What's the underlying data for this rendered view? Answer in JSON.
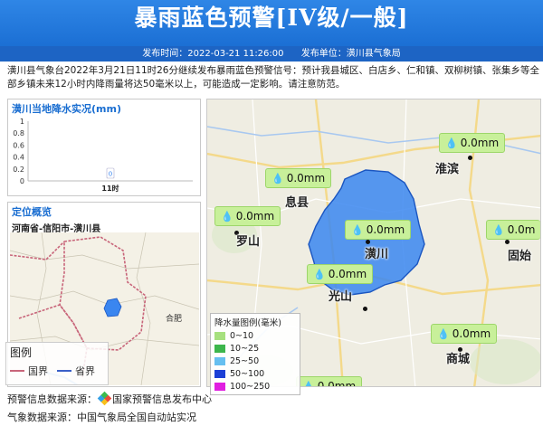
{
  "banner": {
    "title": "暴雨蓝色预警[IV级/一般]"
  },
  "meta": {
    "publish_time": "发布时间：2022-03-21 11:26:00",
    "publisher": "发布单位：潢川县气象局"
  },
  "description": "潢川县气象台2022年3月21日11时26分继续发布暴雨蓝色预警信号：预计我县城区、白店乡、仁和镇、双柳树镇、张集乡等全部乡镇未来12小时内降雨量将达50毫米以上，可能造成一定影响。请注意防范。",
  "rain_panel": {
    "title": "潢川当地降水实况(mm)",
    "chart_data": {
      "type": "bar",
      "categories": [
        "11时"
      ],
      "values": [
        0
      ],
      "data_labels": [
        "0"
      ],
      "ylim": [
        0,
        1
      ],
      "yticks": [
        "0",
        "0.2",
        "0.4",
        "0.6",
        "0.8",
        "1"
      ]
    }
  },
  "loc_panel": {
    "title": "定位概览",
    "subtitle": "河南省-信阳市-潢川县",
    "minimap_label": "合肥",
    "legend": {
      "title": "图例",
      "national": "国界",
      "provincial": "省界"
    }
  },
  "map": {
    "bubbles": [
      {
        "name": "bubble-xixian",
        "value": "0.0mm"
      },
      {
        "name": "bubble-luoshan",
        "value": "0.0mm"
      },
      {
        "name": "bubble-huangchuan",
        "value": "0.0mm"
      },
      {
        "name": "bubble-guangshan",
        "value": "0.0mm"
      },
      {
        "name": "bubble-huaibin",
        "value": "0.0mm"
      },
      {
        "name": "bubble-gushi",
        "value": "0.0m"
      },
      {
        "name": "bubble-shangcheng",
        "value": "0.0mm"
      },
      {
        "name": "bubble-bottom",
        "value": "0.0mm"
      }
    ],
    "cities": {
      "xixian": "息县",
      "luoshan": "罗山",
      "huangchuan": "潢川",
      "guangshan": "光山",
      "huaibin": "淮滨",
      "gushi": "固始",
      "shangcheng": "商城"
    },
    "scale": {
      "title": "降水量图例(毫米)",
      "items": [
        {
          "label": "0~10",
          "color": "#a6e07e"
        },
        {
          "label": "10~25",
          "color": "#3cb64c"
        },
        {
          "label": "25~50",
          "color": "#66bff0"
        },
        {
          "label": "50~100",
          "color": "#1b3fd6"
        },
        {
          "label": "100~250",
          "color": "#e01ee0"
        }
      ]
    }
  },
  "footer": {
    "warning_source_label": "预警信息数据来源：",
    "warning_source": "国家预警信息发布中心",
    "weather_source": "气象数据来源：中国气象局全国自动站实况"
  },
  "colors": {
    "banner": "#1b6fd4",
    "warning_area": "#3a86f0",
    "bubble": "#c8f09a"
  }
}
